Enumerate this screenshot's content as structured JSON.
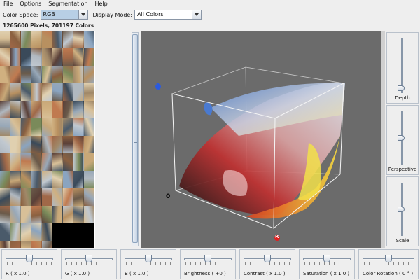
{
  "menu": [
    "File",
    "Options",
    "Segmentation",
    "Help"
  ],
  "toolbar": {
    "color_space_label": "Color Space:",
    "color_space_value": "RGB",
    "display_mode_label": "Display Mode:",
    "display_mode_value": "All Colors"
  },
  "status": "1265600 Pixels, 701197 Colors",
  "viewport": {
    "axis_b": "B",
    "axis_r": "R",
    "axis_origin": "0",
    "background": "#6b6b6b"
  },
  "right_sliders": [
    {
      "label": "Depth",
      "level": 0.05
    },
    {
      "label": "Perspective",
      "level": 0.5
    },
    {
      "label": "Scale",
      "level": 0.5
    }
  ],
  "bottom_sliders": [
    {
      "label": "R ( x 1.0 )",
      "level": 0.5
    },
    {
      "label": "G ( x 1.0 )",
      "level": 0.5
    },
    {
      "label": "B ( x 1.0 )",
      "level": 0.5
    },
    {
      "label": "Brightness ( +0 )",
      "level": 0.5
    },
    {
      "label": "Contrast ( x 1.0 )",
      "level": 0.5
    },
    {
      "label": "Saturation ( x 1.0 )",
      "level": 0.5
    },
    {
      "label": "Color Rotation ( 0 ° )",
      "level": 0.5
    }
  ],
  "thumb_palette": [
    "#6a5a4a",
    "#c8a878",
    "#8aa4c0",
    "#a06848",
    "#d8c098",
    "#4a5a6a",
    "#b0b8c0",
    "#c07a50",
    "#7a8a5a",
    "#e0d0b0",
    "#5a4038",
    "#98a8b8",
    "#b89060",
    "#3a4a5a",
    "#d0b080",
    "#8a6040",
    "#c0c8d0",
    "#a08868"
  ]
}
